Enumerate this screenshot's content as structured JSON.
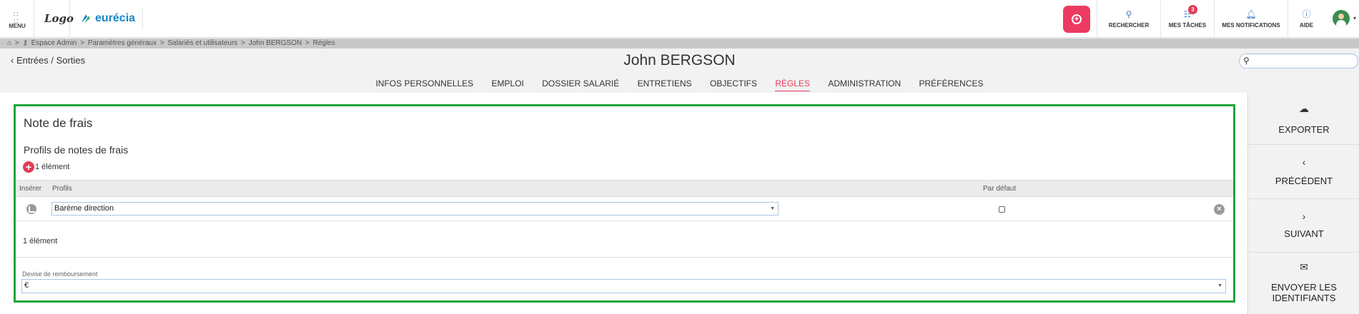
{
  "topbar": {
    "menu_label": "MENU",
    "logo_text": "Logo",
    "brand_name": "eurécia",
    "tools": [
      {
        "label": "RECHERCHER",
        "icon": "search-icon"
      },
      {
        "label": "MES TÂCHES",
        "icon": "tasks-icon",
        "badge": "3"
      },
      {
        "label": "MES NOTIFICATIONS",
        "icon": "bell-icon"
      },
      {
        "label": "AIDE",
        "icon": "help-icon"
      }
    ]
  },
  "breadcrumb": [
    "Espace Admin",
    "Paramètres généraux",
    "Salariés et utilisateurs",
    "John BERGSON",
    "Règles"
  ],
  "header": {
    "back_label": "Entrées / Sorties",
    "title": "John BERGSON",
    "search_placeholder": ""
  },
  "tabs": [
    {
      "label": "INFOS PERSONNELLES",
      "active": false
    },
    {
      "label": "EMPLOI",
      "active": false
    },
    {
      "label": "DOSSIER SALARIÉ",
      "active": false
    },
    {
      "label": "ENTRETIENS",
      "active": false
    },
    {
      "label": "OBJECTIFS",
      "active": false
    },
    {
      "label": "RÈGLES",
      "active": true
    },
    {
      "label": "ADMINISTRATION",
      "active": false
    },
    {
      "label": "PRÉFÉRENCES",
      "active": false
    }
  ],
  "main": {
    "section_title": "Note de frais",
    "subsection_title": "Profils de notes de frais",
    "count_top": "1 élément",
    "columns": {
      "insert": "Insérer",
      "profiles": "Profils",
      "default": "Par défaut"
    },
    "rows": [
      {
        "profile": "Barème direction",
        "default": false
      }
    ],
    "count_bottom": "1 élément",
    "devise_label": "Devise de remboursement",
    "devise_value": "€"
  },
  "sidebar": [
    {
      "label": "EXPORTER",
      "icon": "cloud-upload-icon"
    },
    {
      "label": "PRÉCÉDENT",
      "icon": "chevron-left-icon"
    },
    {
      "label": "SUIVANT",
      "icon": "chevron-right-icon"
    },
    {
      "label": "ENVOYER LES IDENTIFIANTS",
      "icon": "envelope-icon"
    }
  ],
  "colors": {
    "accent": "#e23c55",
    "highlight_border": "#22a53a",
    "brand": "#1786c5"
  }
}
